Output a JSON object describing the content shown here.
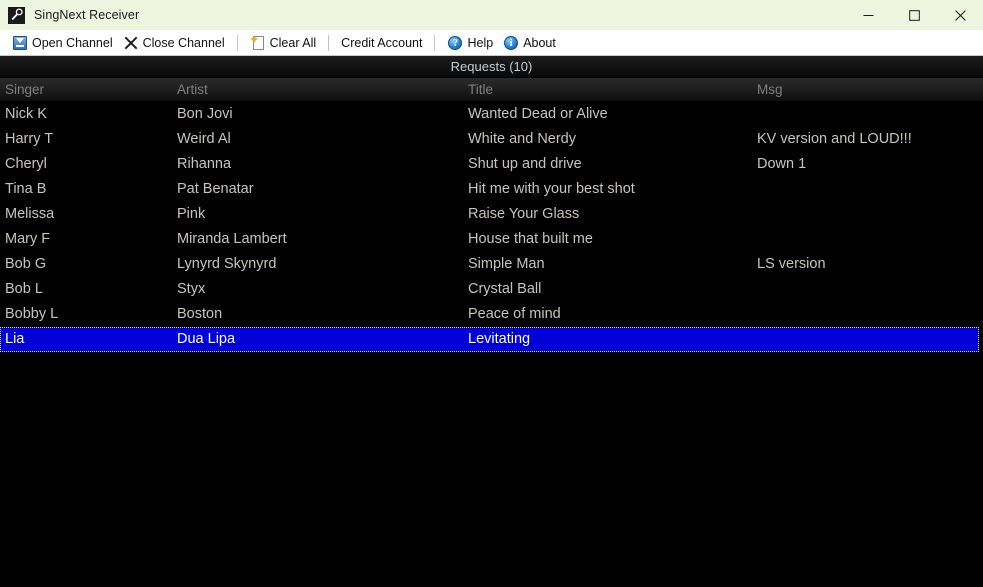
{
  "window": {
    "title": "SingNext Receiver",
    "icon": "microphone-icon",
    "controls": {
      "minimize": "—",
      "maximize": "□",
      "close": "✕"
    }
  },
  "toolbar": {
    "items": [
      {
        "label": "Open Channel",
        "icon": "open-channel-icon"
      },
      {
        "label": "Close Channel",
        "icon": "close-channel-icon"
      },
      {
        "label": "Clear All",
        "icon": "clear-all-icon"
      },
      {
        "label": "Credit Account",
        "icon": "none"
      },
      {
        "label": "Help",
        "icon": "help-icon",
        "glyph": "?"
      },
      {
        "label": "About",
        "icon": "about-icon",
        "glyph": "i"
      }
    ]
  },
  "list": {
    "title": "Requests (10)",
    "columns": [
      {
        "key": "singer",
        "label": "Singer"
      },
      {
        "key": "artist",
        "label": "Artist"
      },
      {
        "key": "title",
        "label": "Title"
      },
      {
        "key": "msg",
        "label": "Msg"
      }
    ],
    "rows": [
      {
        "singer": "Nick K",
        "artist": "Bon Jovi",
        "title": "Wanted Dead or Alive",
        "msg": "",
        "selected": false
      },
      {
        "singer": "Harry T",
        "artist": "Weird Al",
        "title": "White and Nerdy",
        "msg": "KV version and LOUD!!!",
        "selected": false
      },
      {
        "singer": "Cheryl",
        "artist": "Rihanna",
        "title": "Shut up and drive",
        "msg": "Down 1",
        "selected": false
      },
      {
        "singer": "Tina B",
        "artist": "Pat Benatar",
        "title": "Hit me with your best shot",
        "msg": "",
        "selected": false
      },
      {
        "singer": "Melissa",
        "artist": "Pink",
        "title": "Raise Your Glass",
        "msg": "",
        "selected": false
      },
      {
        "singer": "Mary F",
        "artist": "Miranda Lambert",
        "title": "House that built me",
        "msg": "",
        "selected": false
      },
      {
        "singer": "Bob G",
        "artist": "Lynyrd Skynyrd",
        "title": "Simple Man",
        "msg": "LS version",
        "selected": false
      },
      {
        "singer": "Bob L",
        "artist": "Styx",
        "title": "Crystal Ball",
        "msg": "",
        "selected": false
      },
      {
        "singer": "Bobby L",
        "artist": "Boston",
        "title": "Peace of mind",
        "msg": "",
        "selected": false
      },
      {
        "singer": "Lia",
        "artist": "Dua Lipa",
        "title": "Levitating",
        "msg": "",
        "selected": true
      }
    ]
  },
  "colors": {
    "titlebar_bg": "#eef5df",
    "toolbar_bg": "#ffffff",
    "list_bg": "#000000",
    "list_text": "#c9c4bb",
    "header_text": "#7f7f7f",
    "title_text": "#c3cdd6",
    "selection_bg": "#0000d8",
    "selection_text": "#ffffff",
    "focus_border": "#f4e04a"
  }
}
